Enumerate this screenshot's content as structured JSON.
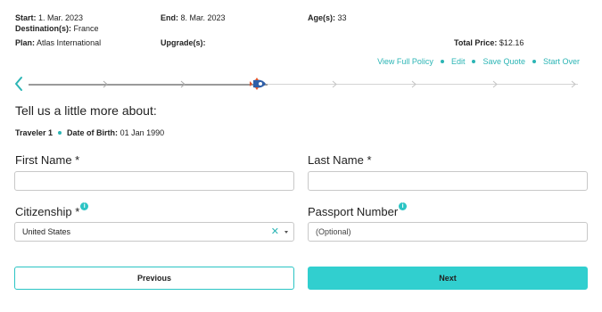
{
  "summary": {
    "start_label": "Start:",
    "start_value": "1. Mar. 2023",
    "destination_label": "Destination(s):",
    "destination_value": "France",
    "plan_label": "Plan:",
    "plan_value": "Atlas International",
    "end_label": "End:",
    "end_value": "8. Mar. 2023",
    "upgrade_label": "Upgrade(s):",
    "ages_label": "Age(s):",
    "ages_value": "33",
    "price_label": "Total Price:",
    "price_value": "$12.16"
  },
  "links": {
    "view_policy": "View Full Policy",
    "edit": "Edit",
    "save_quote": "Save Quote",
    "start_over": "Start Over"
  },
  "progress": {
    "completed_fraction": 0.42,
    "total_steps": 7,
    "current_step": 3
  },
  "heading": "Tell us a little more about:",
  "traveler": {
    "name": "Traveler 1",
    "dob_label": "Date of Birth:",
    "dob_value": "01 Jan 1990"
  },
  "form": {
    "first_name_label": "First Name *",
    "first_name_value": "",
    "last_name_label": "Last Name *",
    "last_name_value": "",
    "citizenship_label": "Citizenship *",
    "citizenship_value": "United States",
    "passport_label": "Passport Number",
    "passport_placeholder": "(Optional)",
    "info_glyph": "i"
  },
  "buttons": {
    "previous": "Previous",
    "next": "Next"
  },
  "icons": {
    "clear": "clear-x-icon",
    "caret": "chevron-down-icon",
    "back": "chevron-left-icon",
    "rocket": "rocket-icon"
  },
  "colors": {
    "accent": "#31cfcf",
    "link": "#2bb5b5",
    "border": "#c8c8c8"
  }
}
